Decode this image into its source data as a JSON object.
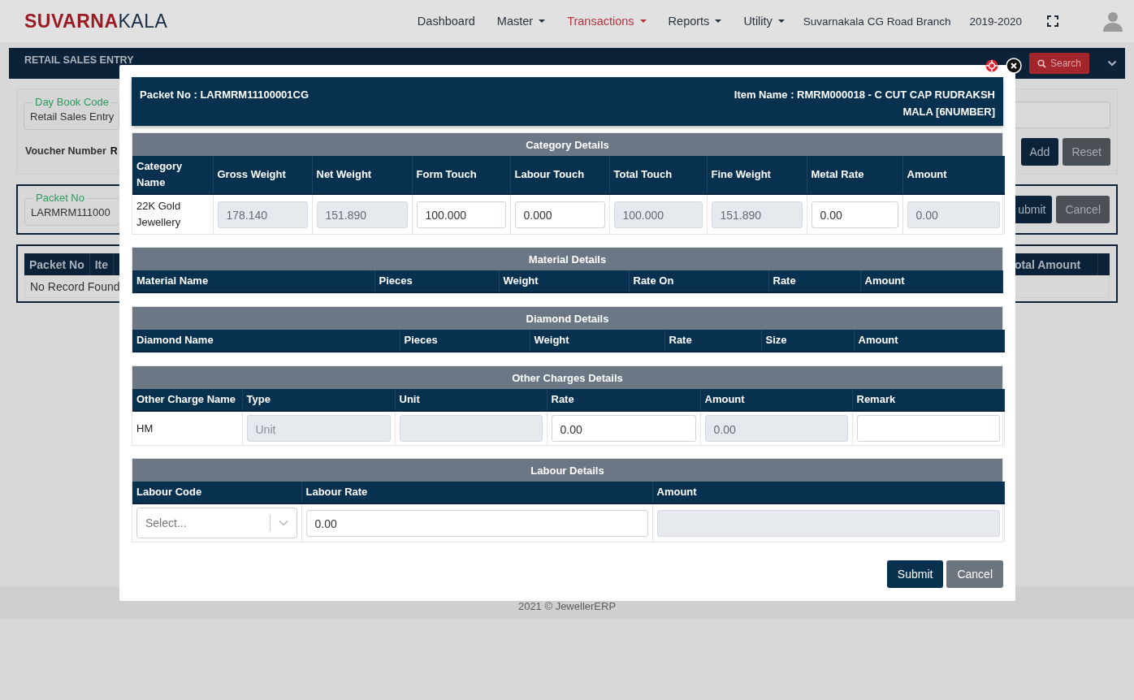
{
  "navbar": {
    "brand_primary": "SUVARNA",
    "brand_secondary": "KALA",
    "menu": [
      {
        "label": "Dashboard",
        "has_caret": false,
        "selected": false
      },
      {
        "label": "Master",
        "has_caret": true,
        "selected": false
      },
      {
        "label": "Transactions",
        "has_caret": true,
        "selected": true
      },
      {
        "label": "Reports",
        "has_caret": true,
        "selected": false
      },
      {
        "label": "Utility",
        "has_caret": true,
        "selected": false
      }
    ],
    "branch": "Suvarnakala CG Road Branch",
    "year": "2019-2020"
  },
  "page": {
    "title": "RETAIL SALES ENTRY",
    "search_button": "Search",
    "entry_card": {
      "legend": "Day Book Code",
      "value": "Retail Sales Entry",
      "voucher_label": "Voucher Number",
      "voucher_value": "R",
      "buttons": [
        "Add",
        "Reset"
      ]
    },
    "packet_card": {
      "legend": "Packet No",
      "value": "LARMRM111000",
      "buttons": [
        "ubmit",
        "Cancel"
      ]
    },
    "records": {
      "columns_left": [
        "Packet No",
        "Ite"
      ],
      "columns_right": [
        "otal Amount"
      ],
      "empty_text": "No Record Found"
    },
    "footer": "2021 © JewellerERP"
  },
  "modal": {
    "packet_no": "Packet No : LARMRM11100001CG",
    "item_name": "Item Name : RMRM000018 - C CUT CAP RUDRAKSH MALA [6NUMBER]",
    "sections": [
      {
        "title": "Category Details",
        "columns": [
          "Category Name",
          "Gross Weight",
          "Net Weight",
          "Form Touch",
          "Labour Touch",
          "Total Touch",
          "Fine Weight",
          "Metal Rate",
          "Amount"
        ],
        "rows": [
          {
            "cells": [
              {
                "kind": "text",
                "text": "22K Gold Jewellery"
              },
              {
                "kind": "input",
                "value": "178.140",
                "disabled": true
              },
              {
                "kind": "input",
                "value": "151.890",
                "disabled": true
              },
              {
                "kind": "input",
                "value": "100.000",
                "disabled": false
              },
              {
                "kind": "input",
                "value": "0.000",
                "disabled": false
              },
              {
                "kind": "input",
                "value": "100.000",
                "disabled": true
              },
              {
                "kind": "input",
                "value": "151.890",
                "disabled": true
              },
              {
                "kind": "input",
                "value": "0.00",
                "disabled": false
              },
              {
                "kind": "input",
                "value": "0.00",
                "disabled": true
              }
            ]
          }
        ]
      },
      {
        "title": "Material Details",
        "columns": [
          "Material Name",
          "Pieces",
          "Weight",
          "Rate On",
          "Rate",
          "Amount"
        ]
      },
      {
        "title": "Diamond Details",
        "columns": [
          "Diamond Name",
          "Pieces",
          "Weight",
          "Rate",
          "Size",
          "Amount"
        ]
      },
      {
        "title": "Other Charges Details",
        "columns": [
          "Other Charge Name",
          "Type",
          "Unit",
          "Rate",
          "Amount",
          "Remark"
        ],
        "rows": [
          {
            "cells": [
              {
                "kind": "text",
                "text": "HM"
              },
              {
                "kind": "input",
                "placeholder": "Unit",
                "disabled": true
              },
              {
                "kind": "input",
                "disabled": true
              },
              {
                "kind": "input",
                "value": "0.00",
                "disabled": false
              },
              {
                "kind": "input",
                "value": "0.00",
                "disabled": true
              },
              {
                "kind": "input",
                "disabled": false
              }
            ]
          }
        ]
      },
      {
        "title": "Labour Details",
        "columns": [
          "Labour Code",
          "Labour Rate",
          "Amount"
        ],
        "rows": [
          {
            "cells": [
              {
                "kind": "select",
                "placeholder": "Select..."
              },
              {
                "kind": "input",
                "value": "0.00",
                "disabled": false
              },
              {
                "kind": "input",
                "disabled": true
              }
            ]
          }
        ]
      }
    ],
    "buttons": [
      {
        "label": "Submit",
        "kind": "primary"
      },
      {
        "label": "Cancel",
        "kind": "secondary"
      }
    ]
  }
}
